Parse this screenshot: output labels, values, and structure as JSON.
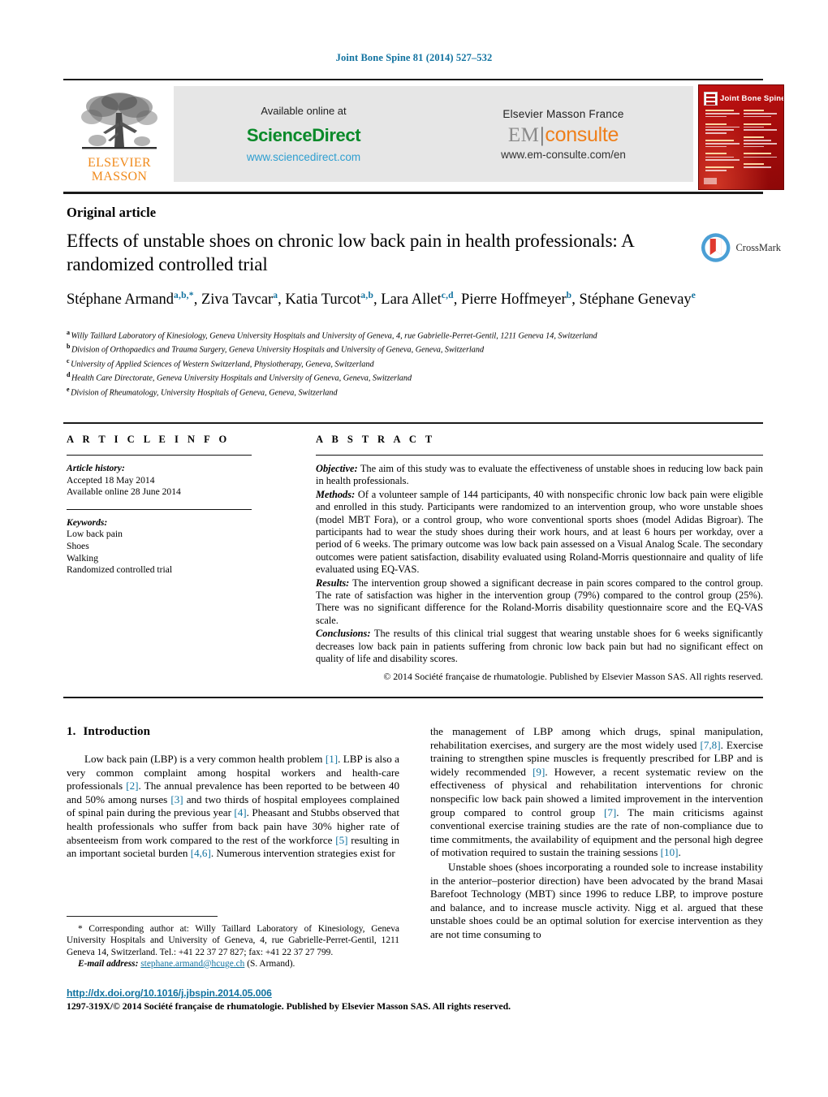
{
  "running_head": "Joint Bone Spine 81 (2014) 527–532",
  "masthead": {
    "publisher_line1": "ELSEVIER",
    "publisher_line2": "MASSON",
    "available_online": "Available online at",
    "sciencedirect": "ScienceDirect",
    "sciencedirect_url": "www.sciencedirect.com",
    "em_france": "Elsevier Masson France",
    "em_prefix": "EM",
    "em_suffix": "consulte",
    "em_url": "www.em-consulte.com/en",
    "cover_title": "Joint Bone Spine"
  },
  "article": {
    "type": "Original article",
    "title": "Effects of unstable shoes on chronic low back pain in health professionals: A randomized controlled trial",
    "crossmark_label": "CrossMark"
  },
  "authors": {
    "list": [
      {
        "name": "Stéphane Armand",
        "sup": "a,b,*"
      },
      {
        "name": "Ziva Tavcar",
        "sup": "a"
      },
      {
        "name": "Katia Turcot",
        "sup": "a,b"
      },
      {
        "name": "Lara Allet",
        "sup": "c,d"
      },
      {
        "name": "Pierre Hoffmeyer",
        "sup": "b"
      },
      {
        "name": "Stéphane Genevay",
        "sup": "e"
      }
    ]
  },
  "affiliations": [
    {
      "mark": "a",
      "text": "Willy Taillard Laboratory of Kinesiology, Geneva University Hospitals and University of Geneva, 4, rue Gabrielle-Perret-Gentil, 1211 Geneva 14, Switzerland"
    },
    {
      "mark": "b",
      "text": "Division of Orthopaedics and Trauma Surgery, Geneva University Hospitals and University of Geneva, Geneva, Switzerland"
    },
    {
      "mark": "c",
      "text": "University of Applied Sciences of Western Switzerland, Physiotherapy, Geneva, Switzerland"
    },
    {
      "mark": "d",
      "text": "Health Care Directorate, Geneva University Hospitals and University of Geneva, Geneva, Switzerland"
    },
    {
      "mark": "e",
      "text": "Division of Rheumatology, University Hospitals of Geneva, Geneva, Switzerland"
    }
  ],
  "article_info": {
    "heading": "A R T I C L E    I N F O",
    "history_label": "Article history:",
    "accepted": "Accepted 18 May 2014",
    "available_online": "Available online 28 June 2014",
    "keywords_label": "Keywords:",
    "keywords": [
      "Low back pain",
      "Shoes",
      "Walking",
      "Randomized controlled trial"
    ]
  },
  "abstract": {
    "heading": "A B S T R A C T",
    "objective_label": "Objective:",
    "objective": "The aim of this study was to evaluate the effectiveness of unstable shoes in reducing low back pain in health professionals.",
    "methods_label": "Methods:",
    "methods": "Of a volunteer sample of 144 participants, 40 with nonspecific chronic low back pain were eligible and enrolled in this study. Participants were randomized to an intervention group, who wore unstable shoes (model MBT Fora), or a control group, who wore conventional sports shoes (model Adidas Bigroar). The participants had to wear the study shoes during their work hours, and at least 6 hours per workday, over a period of 6 weeks. The primary outcome was low back pain assessed on a Visual Analog Scale. The secondary outcomes were patient satisfaction, disability evaluated using Roland-Morris questionnaire and quality of life evaluated using EQ-VAS.",
    "results_label": "Results:",
    "results": "The intervention group showed a significant decrease in pain scores compared to the control group. The rate of satisfaction was higher in the intervention group (79%) compared to the control group (25%). There was no significant difference for the Roland-Morris disability questionnaire score and the EQ-VAS scale.",
    "conclusions_label": "Conclusions:",
    "conclusions": "The results of this clinical trial suggest that wearing unstable shoes for 6 weeks significantly decreases low back pain in patients suffering from chronic low back pain but had no significant effect on quality of life and disability scores.",
    "copyright": "© 2014 Société française de rhumatologie. Published by Elsevier Masson SAS. All rights reserved."
  },
  "introduction": {
    "number": "1.",
    "heading": "Introduction",
    "left_p1_a": "Low back pain (LBP) is a very common health problem ",
    "left_r1": "[1]",
    "left_p1_b": ". LBP is also a very common complaint among hospital workers and health-care professionals ",
    "left_r2": "[2]",
    "left_p1_c": ". The annual prevalence has been reported to be between 40 and 50% among nurses ",
    "left_r3": "[3]",
    "left_p1_d": " and two thirds of hospital employees complained of spinal pain during the previous year ",
    "left_r4": "[4]",
    "left_p1_e": ". Pheasant and Stubbs observed that health professionals who suffer from back pain have 30% higher rate of absenteeism from work compared to the rest of the workforce ",
    "left_r5": "[5]",
    "left_p1_f": " resulting in an important societal burden ",
    "left_r6": "[4,6]",
    "left_p1_g": ". Numerous intervention strategies exist for",
    "right_p1_a": "the management of LBP among which drugs, spinal manipulation, rehabilitation exercises, and surgery are the most widely used ",
    "right_r1": "[7,8]",
    "right_p1_b": ". Exercise training to strengthen spine muscles is frequently prescribed for LBP and is widely recommended ",
    "right_r2": "[9]",
    "right_p1_c": ". However, a recent systematic review on the effectiveness of physical and rehabilitation interventions for chronic nonspecific low back pain showed a limited improvement in the intervention group compared to control group ",
    "right_r3": "[7]",
    "right_p1_d": ". The main criticisms against conventional exercise training studies are the rate of non-compliance due to time commitments, the availability of equipment and the personal high degree of motivation required to sustain the training sessions ",
    "right_r4": "[10]",
    "right_p1_e": ".",
    "right_p2": "Unstable shoes (shoes incorporating a rounded sole to increase instability in the anterior–posterior direction) have been advocated by the brand Masai Barefoot Technology (MBT) since 1996 to reduce LBP, to improve posture and balance, and to increase muscle activity. Nigg et al. argued that these unstable shoes could be an optimal solution for exercise intervention as they are not time consuming to"
  },
  "footnote": {
    "corresponding": "* Corresponding author at: Willy Taillard Laboratory of Kinesiology, Geneva University Hospitals and University of Geneva, 4, rue Gabrielle-Perret-Gentil, 1211 Geneva 14, Switzerland. Tel.: +41 22 37 27 827; fax: +41 22 37 27 799.",
    "email_label": "E-mail address:",
    "email": "stephane.armand@hcuge.ch",
    "email_suffix": " (S. Armand)."
  },
  "footer": {
    "doi": "http://dx.doi.org/10.1016/j.jbspin.2014.05.006",
    "issn_line": "1297-319X/© 2014 Société française de rhumatologie. Published by Elsevier Masson SAS. All rights reserved."
  },
  "colors": {
    "accent_blue": "#1273a0",
    "elsevier_orange": "#f08a1c",
    "sciencedirect_green": "#0a8a2a",
    "em_orange": "#ef7f1a",
    "cover_red": "#b30d0d"
  }
}
